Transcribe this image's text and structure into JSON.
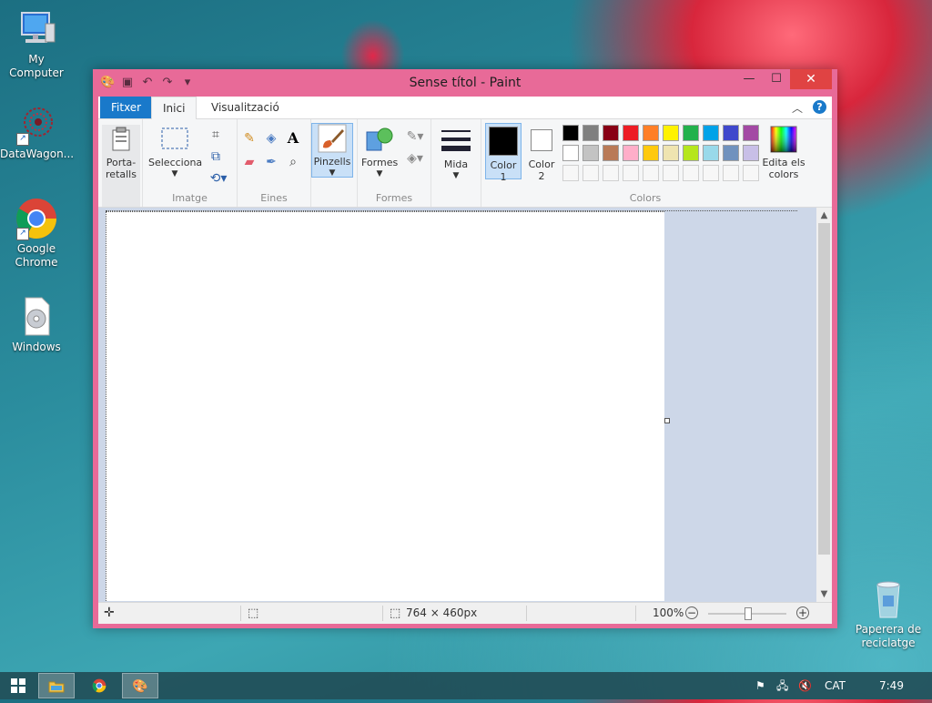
{
  "desktop": {
    "icons": [
      {
        "label": "My Computer"
      },
      {
        "label": "DataWagon..."
      },
      {
        "label": "Google Chrome"
      },
      {
        "label": "Windows"
      },
      {
        "label": "Paperera de reciclatge"
      }
    ]
  },
  "window": {
    "title": "Sense títol - Paint",
    "controls": {
      "minimize": "—",
      "maximize": "☐",
      "close": "✕"
    }
  },
  "ribbon": {
    "tabs": [
      {
        "label": "Fitxer"
      },
      {
        "label": "Inici"
      },
      {
        "label": "Visualització"
      }
    ],
    "collapse_glyph": "︿",
    "help_glyph": "?",
    "groups": {
      "clipboard": {
        "button": "Porta-retalls",
        "line1": "Porta-",
        "line2": "retalls"
      },
      "image": {
        "label": "Imatge",
        "select": "Selecciona"
      },
      "tools": {
        "label": "Eines"
      },
      "brushes": {
        "label": "Pinzells"
      },
      "shapes": {
        "label": "Formes",
        "button": "Formes"
      },
      "size": {
        "label": "Mida"
      },
      "colors": {
        "label": "Colors",
        "color1_line1": "Color",
        "color1_line2": "1",
        "color2_line1": "Color",
        "color2_line2": "2",
        "edit_line1": "Edita els",
        "edit_line2": "colors",
        "color1": "#000000",
        "color2": "#ffffff",
        "palette_row1": [
          "#000000",
          "#7f7f7f",
          "#880015",
          "#ed1c24",
          "#ff7f27",
          "#fff200",
          "#22b14c",
          "#00a2e8",
          "#3f48cc",
          "#a349a4"
        ],
        "palette_row2": [
          "#ffffff",
          "#c3c3c3",
          "#b97a57",
          "#ffaec9",
          "#ffc90e",
          "#efe4b0",
          "#b5e61d",
          "#99d9ea",
          "#7092be",
          "#c8bfe7"
        ]
      }
    }
  },
  "status": {
    "dimensions": "764 × 460px",
    "zoom": "100%"
  },
  "taskbar": {
    "language": "CAT",
    "time": "7:49"
  }
}
